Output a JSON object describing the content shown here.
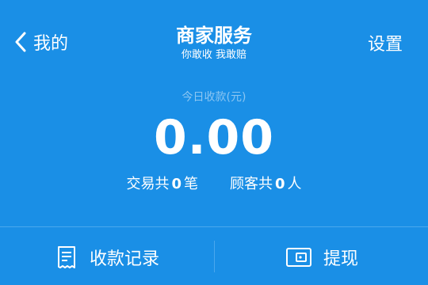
{
  "nav": {
    "back_label": "我的",
    "title": "商家服务",
    "subtitle": "你敢收 我敢赔",
    "settings_label": "设置"
  },
  "summary": {
    "today_label": "今日收款(元)",
    "amount": "0.00",
    "transactions_prefix": "交易共",
    "transactions_count": "0",
    "transactions_unit": "笔",
    "customers_prefix": "顾客共",
    "customers_count": "0",
    "customers_unit": "人"
  },
  "actions": {
    "records_label": "收款记录",
    "records_icon": "receipt-icon",
    "withdraw_label": "提现",
    "withdraw_icon": "wallet-icon"
  },
  "colors": {
    "background": "#1a8fe6",
    "muted_text": "#8cc6f2",
    "divider": "#4aa8ee"
  }
}
